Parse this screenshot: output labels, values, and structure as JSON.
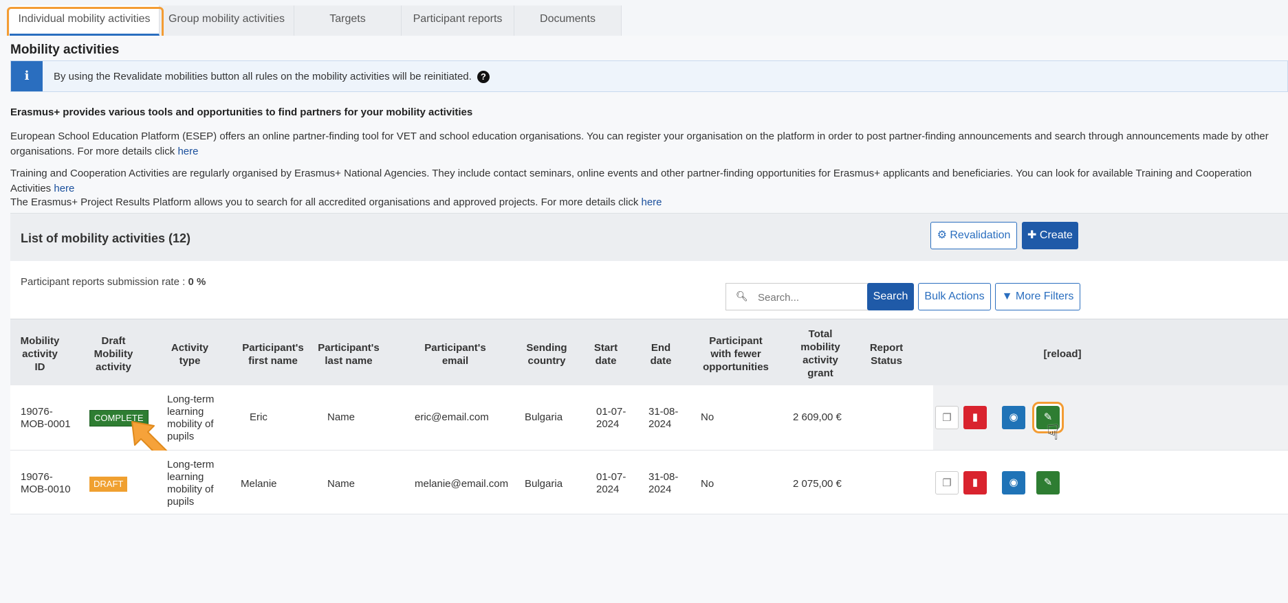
{
  "tabs": [
    {
      "label": "Individual mobility activities",
      "active": true
    },
    {
      "label": "Group mobility activities"
    },
    {
      "label": "Targets"
    },
    {
      "label": "Participant reports"
    },
    {
      "label": "Documents"
    }
  ],
  "page_title": "Mobility activities",
  "info": {
    "text": "By using the Revalidate mobilities button all rules on the mobility activities will be reinitiated.",
    "icon": "info-icon"
  },
  "partners_heading": "Erasmus+ provides various tools and opportunities to find partners for your mobility activities",
  "paragraphs": [
    {
      "text": "European School Education Platform (ESEP) offers an online partner-finding tool for VET and school education organisations. You can register your organisation on the platform in order to post partner-finding announcements and search through announcements made by other organisations. For more details click",
      "link": "here"
    },
    {
      "text": "Training and Cooperation Activities are regularly organised by Erasmus+ National Agencies. They include contact seminars, online events and other partner-finding opportunities for Erasmus+ applicants and beneficiaries. You can look for available Training and Cooperation Activities",
      "link": "here"
    },
    {
      "text": "The Erasmus+ Project Results Platform allows you to search for all accredited organisations and approved projects. For more details click",
      "link": "here"
    }
  ],
  "list": {
    "title": "List of mobility activities (12)",
    "revalidation_label": "Revalidation",
    "create_label": "Create",
    "rate_label": "Participant reports submission rate :",
    "rate_value": "0 %",
    "search_placeholder": "Search...",
    "search_button": "Search",
    "bulk_actions": "Bulk Actions",
    "more_filters": "More Filters",
    "reload": "[reload]"
  },
  "columns": [
    "Mobility activity ID",
    "Draft Mobility activity",
    "Activity type",
    "Participant's first name",
    "Participant's last name",
    "Participant's email",
    "Sending country",
    "Start date",
    "End date",
    "Participant with fewer opportunities",
    "Total mobility activity grant",
    "Report Status"
  ],
  "rows": [
    {
      "id": "19076-MOB-0001",
      "draft": "COMPLETE",
      "draft_color": "#2e7d32",
      "activity_type": "Long-term learning mobility of pupils",
      "first_name": "Eric",
      "last_name": "Name",
      "email": "eric@email.com",
      "country": "Bulgaria",
      "start": "01-07-2024",
      "end": "31-08-2024",
      "fewer": "No",
      "grant": "2 609,00 €",
      "report_status": ""
    },
    {
      "id": "19076-MOB-0010",
      "draft": "DRAFT",
      "draft_color": "#f0a030",
      "activity_type": "Long-term learning mobility of pupils",
      "first_name": "Melanie",
      "last_name": "Name",
      "email": "melanie@email.com",
      "country": "Bulgaria",
      "start": "01-07-2024",
      "end": "31-08-2024",
      "fewer": "No",
      "grant": "2 075,00 €",
      "report_status": ""
    }
  ],
  "colors": {
    "primary": "#1f5aa8",
    "highlight": "#f39c33",
    "complete": "#2e7d32",
    "draft": "#f0a030",
    "delete": "#d9232e",
    "view": "#1f73b7"
  }
}
